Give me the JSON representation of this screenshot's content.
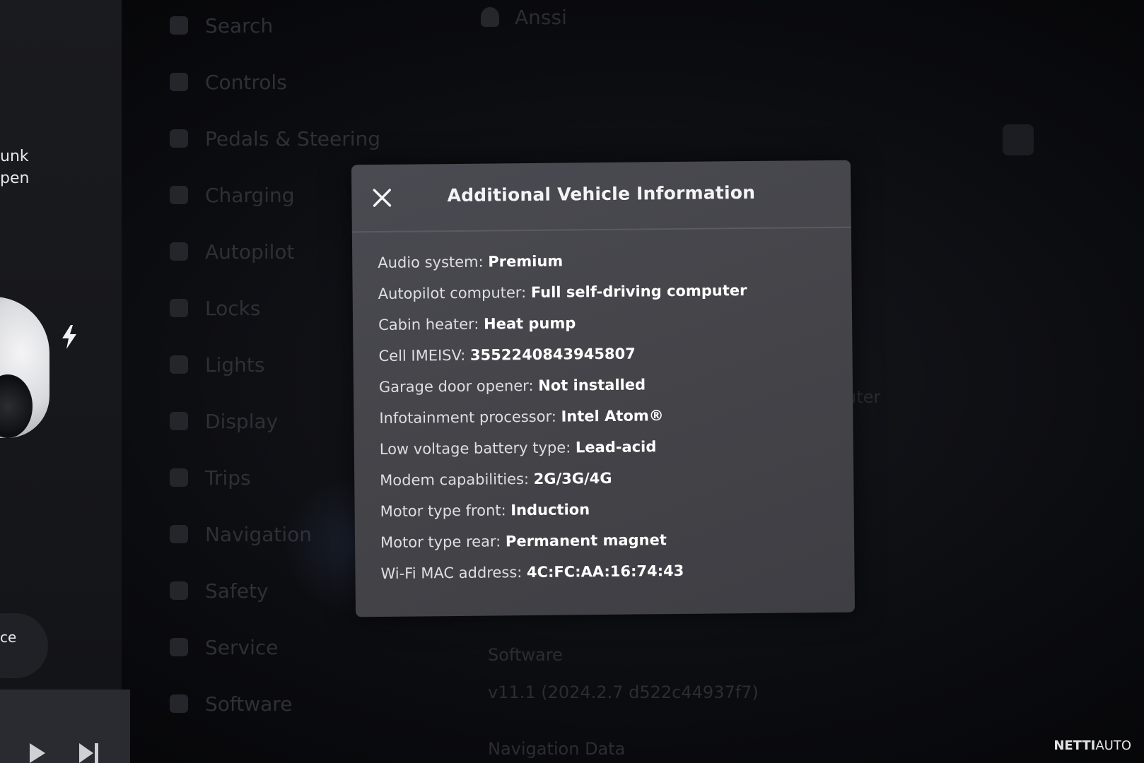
{
  "car_panel": {
    "trunk_line1": "unk",
    "trunk_line2": "pen",
    "device_label": "ce"
  },
  "icons": {
    "close": "close-icon",
    "bolt": "lightning-bolt-icon",
    "play": "play-icon",
    "next": "skip-next-icon"
  },
  "background": {
    "user_name": "Anssi",
    "menu_items": [
      {
        "label": "Search"
      },
      {
        "label": "Controls"
      },
      {
        "label": "Pedals & Steering"
      },
      {
        "label": "Charging"
      },
      {
        "label": "Autopilot"
      },
      {
        "label": "Locks"
      },
      {
        "label": "Lights"
      },
      {
        "label": "Display"
      },
      {
        "label": "Trips"
      },
      {
        "label": "Navigation"
      },
      {
        "label": "Safety"
      },
      {
        "label": "Service"
      },
      {
        "label": "Software"
      }
    ],
    "software_heading": "Software",
    "software_version": "v11.1 (2024.2.7 d522c44937f7)",
    "navigation_data": "Navigation Data",
    "partial_text": "uter"
  },
  "modal": {
    "title": "Additional Vehicle Information",
    "rows": [
      {
        "label": "Audio system: ",
        "value": "Premium"
      },
      {
        "label": "Autopilot computer: ",
        "value": "Full self-driving computer"
      },
      {
        "label": "Cabin heater: ",
        "value": "Heat pump"
      },
      {
        "label": "Cell IMEISV: ",
        "value": "3552240843945807"
      },
      {
        "label": "Garage door opener: ",
        "value": "Not installed"
      },
      {
        "label": "Infotainment processor: ",
        "value": "Intel Atom®"
      },
      {
        "label": "Low voltage battery type: ",
        "value": "Lead-acid"
      },
      {
        "label": "Modem capabilities: ",
        "value": "2G/3G/4G"
      },
      {
        "label": "Motor type front: ",
        "value": "Induction"
      },
      {
        "label": "Motor type rear: ",
        "value": "Permanent magnet"
      },
      {
        "label": "Wi-Fi MAC address: ",
        "value": "4C:FC:AA:16:74:43"
      }
    ]
  },
  "watermark": {
    "bold": "NETTI",
    "regular": "AUTO"
  },
  "colors": {
    "modal_bg": "#46464c",
    "accent_link": "#1b2a4c",
    "text_primary": "#ffffff"
  }
}
